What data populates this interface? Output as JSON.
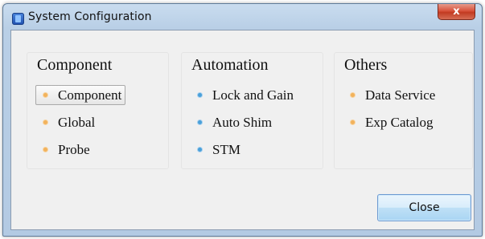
{
  "window": {
    "title": "System Configuration",
    "close_glyph": "x"
  },
  "groups": [
    {
      "title": "Component",
      "items": [
        {
          "label": "Component",
          "selected": true,
          "bullet_color": "#f2b25c"
        },
        {
          "label": "Global",
          "selected": false,
          "bullet_color": "#f2b25c"
        },
        {
          "label": "Probe",
          "selected": false,
          "bullet_color": "#f2b25c"
        }
      ]
    },
    {
      "title": "Automation",
      "items": [
        {
          "label": "Lock and Gain",
          "selected": false,
          "bullet_color": "#4aa0d9"
        },
        {
          "label": "Auto Shim",
          "selected": false,
          "bullet_color": "#4aa0d9"
        },
        {
          "label": "STM",
          "selected": false,
          "bullet_color": "#4aa0d9"
        }
      ]
    },
    {
      "title": "Others",
      "items": [
        {
          "label": "Data Service",
          "selected": false,
          "bullet_color": "#f2b25c"
        },
        {
          "label": "Exp Catalog",
          "selected": false,
          "bullet_color": "#f2b25c"
        }
      ]
    }
  ],
  "footer": {
    "close_label": "Close"
  },
  "icons": {
    "app": "app-icon",
    "window_close": "close-icon"
  }
}
